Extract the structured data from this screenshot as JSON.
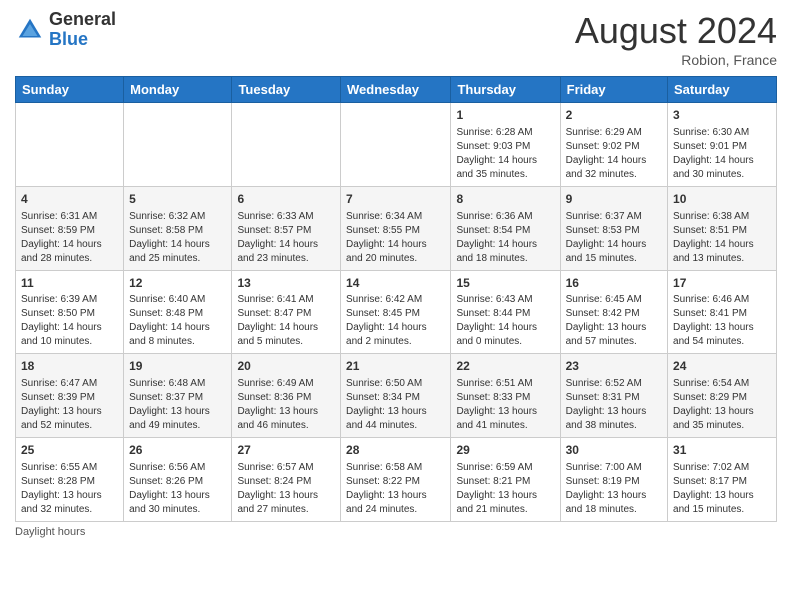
{
  "header": {
    "logo_general": "General",
    "logo_blue": "Blue",
    "month_year": "August 2024",
    "location": "Robion, France"
  },
  "footer": {
    "daylight_label": "Daylight hours"
  },
  "days_of_week": [
    "Sunday",
    "Monday",
    "Tuesday",
    "Wednesday",
    "Thursday",
    "Friday",
    "Saturday"
  ],
  "weeks": [
    [
      {
        "day": "",
        "info": ""
      },
      {
        "day": "",
        "info": ""
      },
      {
        "day": "",
        "info": ""
      },
      {
        "day": "",
        "info": ""
      },
      {
        "day": "1",
        "info": "Sunrise: 6:28 AM\nSunset: 9:03 PM\nDaylight: 14 hours and 35 minutes."
      },
      {
        "day": "2",
        "info": "Sunrise: 6:29 AM\nSunset: 9:02 PM\nDaylight: 14 hours and 32 minutes."
      },
      {
        "day": "3",
        "info": "Sunrise: 6:30 AM\nSunset: 9:01 PM\nDaylight: 14 hours and 30 minutes."
      }
    ],
    [
      {
        "day": "4",
        "info": "Sunrise: 6:31 AM\nSunset: 8:59 PM\nDaylight: 14 hours and 28 minutes."
      },
      {
        "day": "5",
        "info": "Sunrise: 6:32 AM\nSunset: 8:58 PM\nDaylight: 14 hours and 25 minutes."
      },
      {
        "day": "6",
        "info": "Sunrise: 6:33 AM\nSunset: 8:57 PM\nDaylight: 14 hours and 23 minutes."
      },
      {
        "day": "7",
        "info": "Sunrise: 6:34 AM\nSunset: 8:55 PM\nDaylight: 14 hours and 20 minutes."
      },
      {
        "day": "8",
        "info": "Sunrise: 6:36 AM\nSunset: 8:54 PM\nDaylight: 14 hours and 18 minutes."
      },
      {
        "day": "9",
        "info": "Sunrise: 6:37 AM\nSunset: 8:53 PM\nDaylight: 14 hours and 15 minutes."
      },
      {
        "day": "10",
        "info": "Sunrise: 6:38 AM\nSunset: 8:51 PM\nDaylight: 14 hours and 13 minutes."
      }
    ],
    [
      {
        "day": "11",
        "info": "Sunrise: 6:39 AM\nSunset: 8:50 PM\nDaylight: 14 hours and 10 minutes."
      },
      {
        "day": "12",
        "info": "Sunrise: 6:40 AM\nSunset: 8:48 PM\nDaylight: 14 hours and 8 minutes."
      },
      {
        "day": "13",
        "info": "Sunrise: 6:41 AM\nSunset: 8:47 PM\nDaylight: 14 hours and 5 minutes."
      },
      {
        "day": "14",
        "info": "Sunrise: 6:42 AM\nSunset: 8:45 PM\nDaylight: 14 hours and 2 minutes."
      },
      {
        "day": "15",
        "info": "Sunrise: 6:43 AM\nSunset: 8:44 PM\nDaylight: 14 hours and 0 minutes."
      },
      {
        "day": "16",
        "info": "Sunrise: 6:45 AM\nSunset: 8:42 PM\nDaylight: 13 hours and 57 minutes."
      },
      {
        "day": "17",
        "info": "Sunrise: 6:46 AM\nSunset: 8:41 PM\nDaylight: 13 hours and 54 minutes."
      }
    ],
    [
      {
        "day": "18",
        "info": "Sunrise: 6:47 AM\nSunset: 8:39 PM\nDaylight: 13 hours and 52 minutes."
      },
      {
        "day": "19",
        "info": "Sunrise: 6:48 AM\nSunset: 8:37 PM\nDaylight: 13 hours and 49 minutes."
      },
      {
        "day": "20",
        "info": "Sunrise: 6:49 AM\nSunset: 8:36 PM\nDaylight: 13 hours and 46 minutes."
      },
      {
        "day": "21",
        "info": "Sunrise: 6:50 AM\nSunset: 8:34 PM\nDaylight: 13 hours and 44 minutes."
      },
      {
        "day": "22",
        "info": "Sunrise: 6:51 AM\nSunset: 8:33 PM\nDaylight: 13 hours and 41 minutes."
      },
      {
        "day": "23",
        "info": "Sunrise: 6:52 AM\nSunset: 8:31 PM\nDaylight: 13 hours and 38 minutes."
      },
      {
        "day": "24",
        "info": "Sunrise: 6:54 AM\nSunset: 8:29 PM\nDaylight: 13 hours and 35 minutes."
      }
    ],
    [
      {
        "day": "25",
        "info": "Sunrise: 6:55 AM\nSunset: 8:28 PM\nDaylight: 13 hours and 32 minutes."
      },
      {
        "day": "26",
        "info": "Sunrise: 6:56 AM\nSunset: 8:26 PM\nDaylight: 13 hours and 30 minutes."
      },
      {
        "day": "27",
        "info": "Sunrise: 6:57 AM\nSunset: 8:24 PM\nDaylight: 13 hours and 27 minutes."
      },
      {
        "day": "28",
        "info": "Sunrise: 6:58 AM\nSunset: 8:22 PM\nDaylight: 13 hours and 24 minutes."
      },
      {
        "day": "29",
        "info": "Sunrise: 6:59 AM\nSunset: 8:21 PM\nDaylight: 13 hours and 21 minutes."
      },
      {
        "day": "30",
        "info": "Sunrise: 7:00 AM\nSunset: 8:19 PM\nDaylight: 13 hours and 18 minutes."
      },
      {
        "day": "31",
        "info": "Sunrise: 7:02 AM\nSunset: 8:17 PM\nDaylight: 13 hours and 15 minutes."
      }
    ]
  ]
}
